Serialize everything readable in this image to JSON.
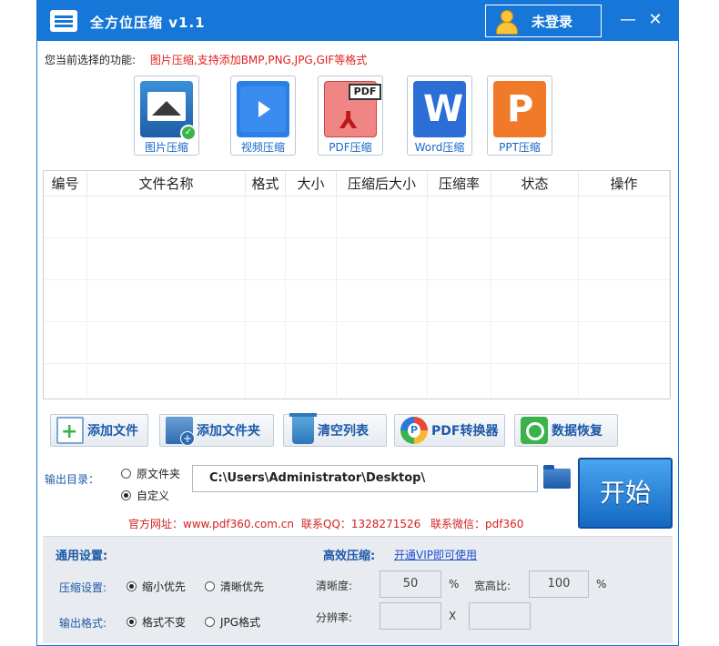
{
  "titlebar": {
    "app_title": "全方位压缩 v1.1",
    "login_label": "未登录",
    "min_glyph": "—",
    "close_glyph": "✕"
  },
  "function": {
    "label": "您当前选择的功能:",
    "value": "图片压缩,支持添加BMP,PNG,JPG,GIF等格式"
  },
  "tools": [
    {
      "label": "图片压缩",
      "icon": "image-compress-icon"
    },
    {
      "label": "视频压缩",
      "icon": "video-compress-icon"
    },
    {
      "label": "PDF压缩",
      "icon": "pdf-compress-icon",
      "tag": "PDF"
    },
    {
      "label": "Word压缩",
      "icon": "word-compress-icon",
      "glyph": "W"
    },
    {
      "label": "PPT压缩",
      "icon": "ppt-compress-icon",
      "glyph": "P"
    }
  ],
  "table": {
    "columns": [
      "编号",
      "文件名称",
      "格式",
      "大小",
      "压缩后大小",
      "压缩率",
      "状态",
      "操作"
    ]
  },
  "actions": {
    "add_file": "添加文件",
    "add_folder": "添加文件夹",
    "clear_list": "清空列表",
    "pdf_converter": "PDF转换器",
    "data_restore": "数据恢复"
  },
  "output": {
    "label": "输出目录：",
    "option_original": "原文件夹",
    "option_custom": "自定义",
    "selected": "自定义",
    "path": "C:\\Users\\Administrator\\Desktop\\"
  },
  "start_label": "开始",
  "info": {
    "website": "官方网址：www.pdf360.com.cn",
    "qq": "联系QQ：1328271526",
    "wechat": "联系微信：pdf360"
  },
  "settings": {
    "general_title": "通用设置:",
    "efficient_title": "高效压缩:",
    "vip_link": "开通VIP即可使用",
    "compress_label": "压缩设置:",
    "compress_opt1": "缩小优先",
    "compress_opt2": "清晰优先",
    "format_label": "输出格式:",
    "format_opt1": "格式不变",
    "format_opt2": "JPG格式",
    "clarity_label": "清晰度:",
    "clarity_value": "50",
    "clarity_unit": "%",
    "ratio_label": "宽高比:",
    "ratio_value": "100",
    "ratio_unit": "%",
    "resolution_label": "分辨率:",
    "resolution_x": "",
    "resolution_sep": "X",
    "resolution_y": ""
  }
}
